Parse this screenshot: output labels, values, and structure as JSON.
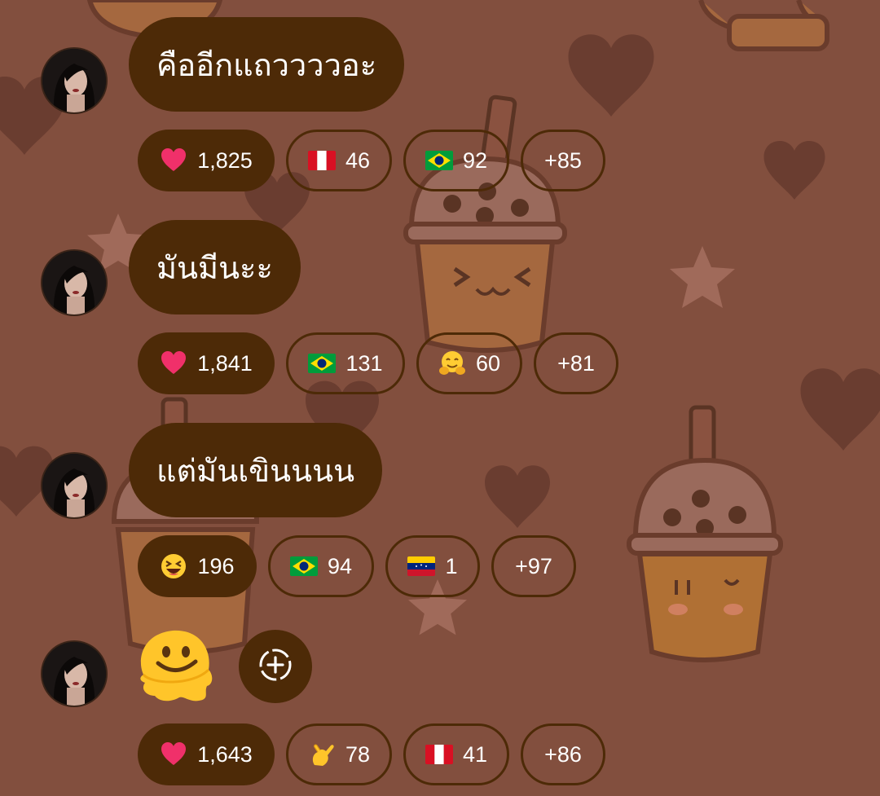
{
  "theme": {
    "background": "#824f3e",
    "bubble_color": "#4d2a07",
    "text_color": "#ffffff"
  },
  "messages": [
    {
      "text": "คืออีกแถววววอะ",
      "reactions": [
        {
          "icon": "red-heart-icon",
          "count": "1,825",
          "style": "filled"
        },
        {
          "icon": "peru-flag-icon",
          "count": "46",
          "style": "outline"
        },
        {
          "icon": "brazil-flag-icon",
          "count": "92",
          "style": "outline"
        },
        {
          "icon": null,
          "count": "+85",
          "style": "outline"
        }
      ]
    },
    {
      "text": "มันมีนะะ",
      "reactions": [
        {
          "icon": "red-heart-icon",
          "count": "1,841",
          "style": "filled"
        },
        {
          "icon": "brazil-flag-icon",
          "count": "131",
          "style": "outline"
        },
        {
          "icon": "hugging-face-icon",
          "count": "60",
          "style": "outline"
        },
        {
          "icon": null,
          "count": "+81",
          "style": "outline"
        }
      ]
    },
    {
      "text": "แต่มันเขินนนน",
      "reactions": [
        {
          "icon": "laughing-face-icon",
          "count": "196",
          "style": "filled"
        },
        {
          "icon": "brazil-flag-icon",
          "count": "94",
          "style": "outline"
        },
        {
          "icon": "venezuela-flag-icon",
          "count": "1",
          "style": "outline"
        },
        {
          "icon": null,
          "count": "+97",
          "style": "outline"
        }
      ]
    },
    {
      "emoji": "melting-face-icon",
      "add_reaction_icon": "add-reaction-icon",
      "reactions": [
        {
          "icon": "red-heart-icon",
          "count": "1,643",
          "style": "filled"
        },
        {
          "icon": "call-me-hand-icon",
          "count": "78",
          "style": "outline"
        },
        {
          "icon": "peru-flag-icon",
          "count": "41",
          "style": "outline"
        },
        {
          "icon": null,
          "count": "+86",
          "style": "outline"
        }
      ]
    }
  ]
}
